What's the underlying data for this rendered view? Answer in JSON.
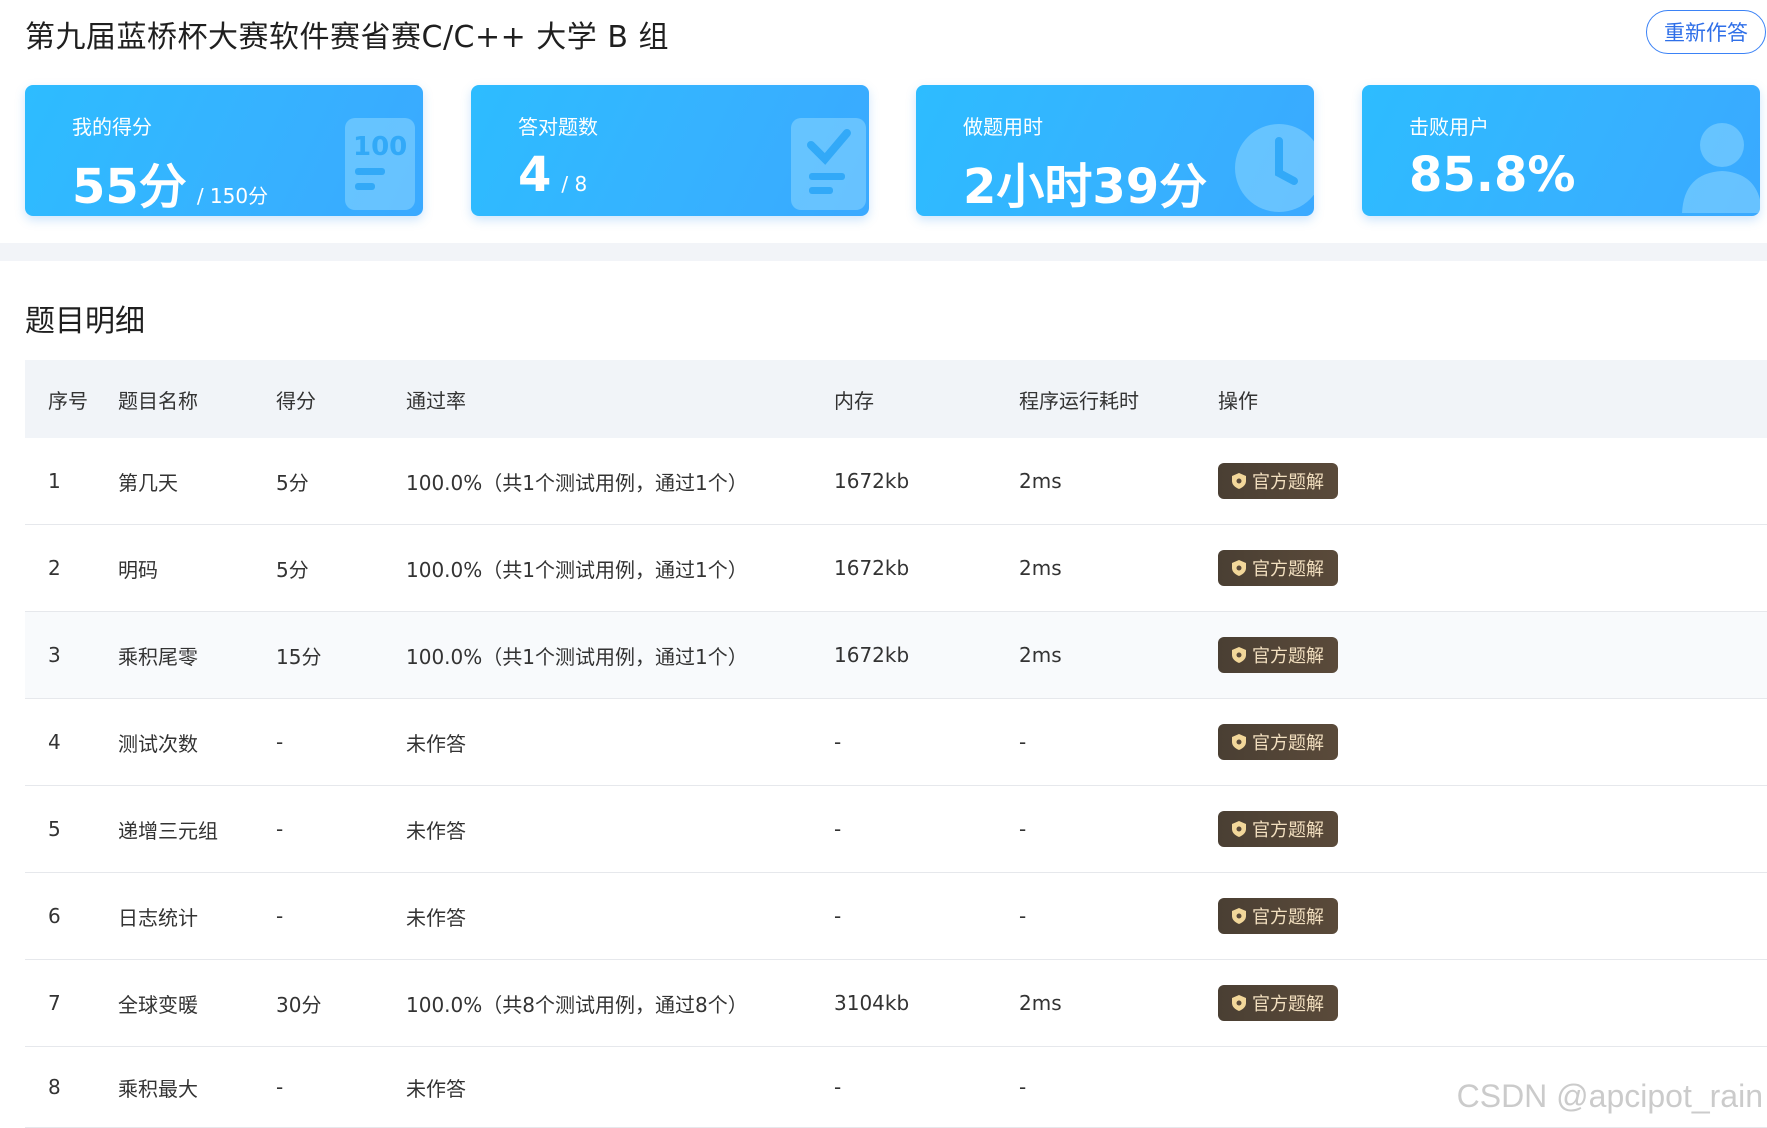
{
  "header": {
    "title": "第九届蓝桥杯大赛软件赛省赛C/C++ 大学 B 组",
    "redo_label": "重新作答"
  },
  "stats": {
    "score": {
      "label": "我的得分",
      "value": "55分",
      "sub": "/ 150分"
    },
    "correct": {
      "label": "答对题数",
      "value": "4",
      "sub": "/ 8"
    },
    "time": {
      "label": "做题用时",
      "value": "2小时39分"
    },
    "beat": {
      "label": "击败用户",
      "value": "85.8%"
    }
  },
  "details": {
    "title": "题目明细",
    "columns": [
      "序号",
      "题目名称",
      "得分",
      "通过率",
      "内存",
      "程序运行耗时",
      "操作"
    ],
    "action_label": "官方题解",
    "rows": [
      {
        "no": "1",
        "name": "第几天",
        "score": "5分",
        "rate": "100.0%（共1个测试用例，通过1个）",
        "memory": "1672kb",
        "time": "2ms"
      },
      {
        "no": "2",
        "name": "明码",
        "score": "5分",
        "rate": "100.0%（共1个测试用例，通过1个）",
        "memory": "1672kb",
        "time": "2ms"
      },
      {
        "no": "3",
        "name": "乘积尾零",
        "score": "15分",
        "rate": "100.0%（共1个测试用例，通过1个）",
        "memory": "1672kb",
        "time": "2ms"
      },
      {
        "no": "4",
        "name": "测试次数",
        "score": "-",
        "rate": "未作答",
        "memory": "-",
        "time": "-"
      },
      {
        "no": "5",
        "name": "递增三元组",
        "score": "-",
        "rate": "未作答",
        "memory": "-",
        "time": "-"
      },
      {
        "no": "6",
        "name": "日志统计",
        "score": "-",
        "rate": "未作答",
        "memory": "-",
        "time": "-"
      },
      {
        "no": "7",
        "name": "全球变暖",
        "score": "30分",
        "rate": "100.0%（共8个测试用例，通过8个）",
        "memory": "3104kb",
        "time": "2ms"
      },
      {
        "no": "8",
        "name": "乘积最大",
        "score": "-",
        "rate": "未作答",
        "memory": "-",
        "time": "-"
      }
    ]
  },
  "watermark": "CSDN @apcipot_rain"
}
